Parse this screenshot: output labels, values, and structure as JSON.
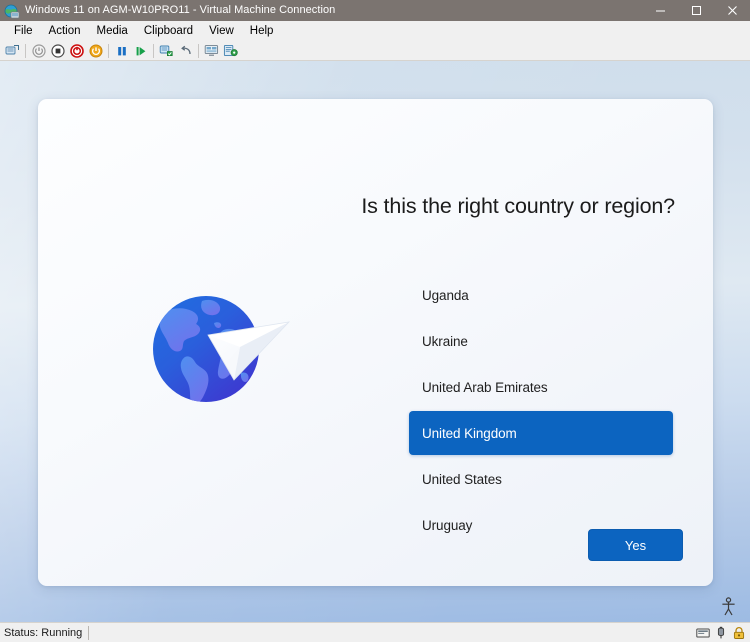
{
  "window": {
    "title": "Windows 11 on AGM-W10PRO11 - Virtual Machine Connection",
    "icon": "vm-connection-icon",
    "controls": {
      "minimize": "─",
      "maximize": "□",
      "close": "✕"
    }
  },
  "menubar": {
    "items": [
      {
        "label": "File"
      },
      {
        "label": "Action"
      },
      {
        "label": "Media"
      },
      {
        "label": "Clipboard"
      },
      {
        "label": "View"
      },
      {
        "label": "Help"
      }
    ]
  },
  "toolbar": {
    "buttons": [
      {
        "name": "ctrl-alt-delete-icon",
        "title": "Ctrl+Alt+Delete"
      },
      {
        "name": "start-icon",
        "title": "Start"
      },
      {
        "name": "shut-down-icon",
        "title": "Shut Down"
      },
      {
        "name": "turn-off-icon",
        "title": "Turn Off"
      },
      {
        "name": "save-state-icon",
        "title": "Save"
      },
      {
        "name": "pause-icon",
        "title": "Pause"
      },
      {
        "name": "resume-icon",
        "title": "Resume"
      },
      {
        "name": "checkpoint-icon",
        "title": "Checkpoint"
      },
      {
        "name": "revert-icon",
        "title": "Revert"
      },
      {
        "name": "enhanced-session-icon",
        "title": "Enhanced Session"
      },
      {
        "name": "settings-icon",
        "title": "Settings"
      }
    ]
  },
  "oobe": {
    "heading": "Is this the right country or region?",
    "illustration": "globe-with-paper-plane",
    "countries": [
      {
        "label": "Uganda",
        "selected": false
      },
      {
        "label": "Ukraine",
        "selected": false
      },
      {
        "label": "United Arab Emirates",
        "selected": false
      },
      {
        "label": "United Kingdom",
        "selected": true
      },
      {
        "label": "United States",
        "selected": false
      },
      {
        "label": "Uruguay",
        "selected": false
      }
    ],
    "primary_button": "Yes",
    "accessibility_icon": "accessibility-person-icon",
    "colors": {
      "accent": "#0c64c0",
      "card": "#f7fafd",
      "text": "#1f1f1f"
    }
  },
  "statusbar": {
    "status": "Status: Running",
    "icons": [
      {
        "name": "display-icon"
      },
      {
        "name": "usb-icon"
      },
      {
        "name": "lock-icon"
      }
    ]
  }
}
